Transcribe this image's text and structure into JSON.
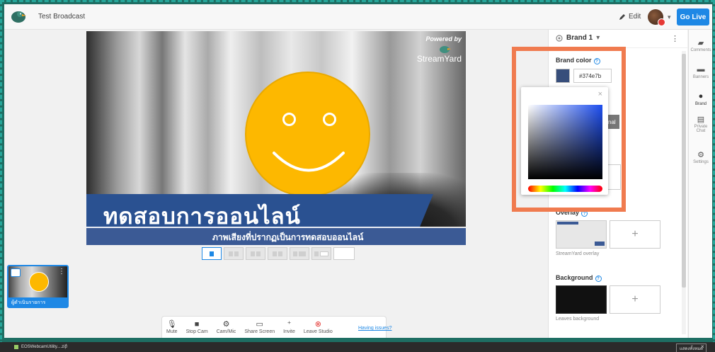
{
  "header": {
    "broadcast_title": "Test Broadcast",
    "edit_label": "Edit",
    "go_live_label": "Go Live"
  },
  "stage": {
    "powered_by": "Powered by",
    "streamyard_text": "StreamYard",
    "banner_title": "ทดสอบการออนไลน์",
    "banner_subtitle": "ภาพเสียงที่ปรากฏเป็นการทดสอบออนไลน์"
  },
  "participant": {
    "name": "ผู้ดำเนินรายการ"
  },
  "controls": [
    {
      "label": "Mute",
      "icon": "mic-icon"
    },
    {
      "label": "Stop Cam",
      "icon": "camera-icon"
    },
    {
      "label": "Cam/Mic",
      "icon": "gear-icon"
    },
    {
      "label": "Share Screen",
      "icon": "monitor-icon"
    },
    {
      "label": "Invite",
      "icon": "add-user-icon"
    },
    {
      "label": "Leave Studio",
      "icon": "leave-icon"
    }
  ],
  "having_issues": "Having issues?",
  "panel": {
    "brand_name": "Brand 1",
    "brand_color_label": "Brand color",
    "brand_color_hex": "#374e7b",
    "theme_stub": "nal",
    "overlay_label": "Overlay",
    "overlay_caption": "StreamYard overlay",
    "background_label": "Background",
    "background_caption": "Leaves background",
    "add_symbol": "+"
  },
  "tabs": [
    {
      "label": "Comments",
      "icon": "comment-icon"
    },
    {
      "label": "Banners",
      "icon": "banner-icon"
    },
    {
      "label": "Brand",
      "icon": "palette-icon"
    },
    {
      "label": "Private Chat",
      "icon": "chat-icon"
    },
    {
      "label": "Settings",
      "icon": "gear-icon"
    }
  ],
  "picker": {
    "close_symbol": "×"
  },
  "taskbar": {
    "file_name": "EOSWebcamUtility....zip",
    "show_all": "แสดงทั้งหมด",
    "close_symbol": "×"
  },
  "colors": {
    "accent": "#1e88e5",
    "brand": "#374e7b",
    "highlight": "#f07b4f",
    "banner": "#2a5191"
  }
}
